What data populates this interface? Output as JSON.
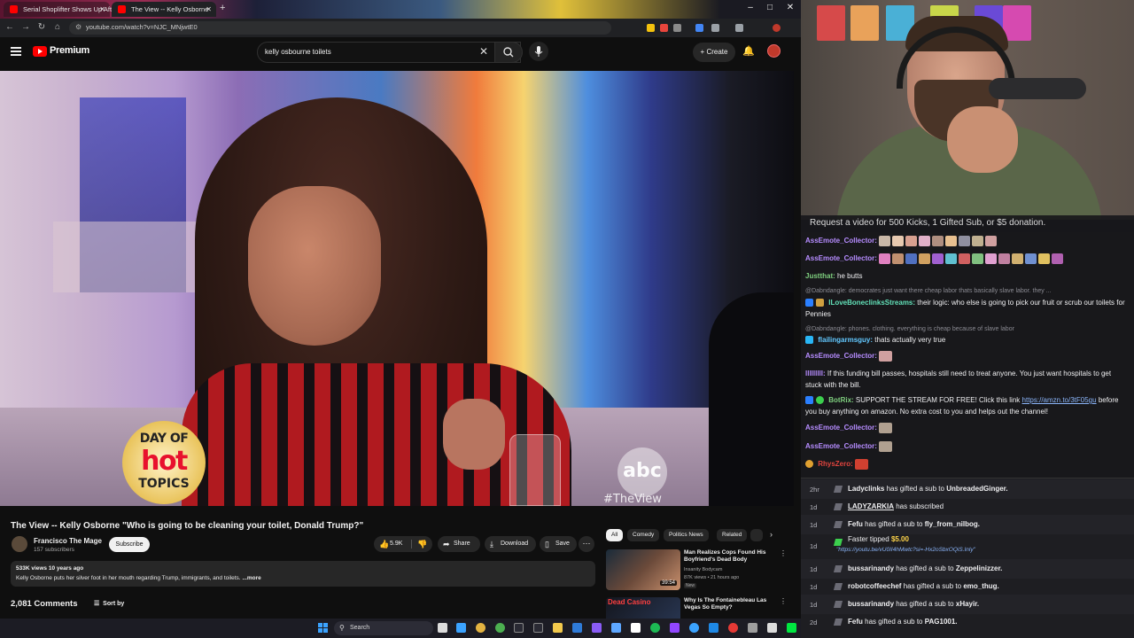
{
  "browser": {
    "tabs": [
      {
        "title": "Serial Shoplifter Shows Up Aft..."
      },
      {
        "title": "The View -- Kelly Osborne"
      }
    ],
    "url": "youtube.com/watch?v=NJC_MNjwtE0"
  },
  "youtube": {
    "brand": "Premium",
    "search_query": "kelly osbourne toilets",
    "create_label": "Create",
    "video": {
      "overlay_line1": "DAY OF",
      "overlay_line2": "hot",
      "overlay_line3": "TOPICS",
      "watermark": "abc",
      "hashtag": "#TheView"
    },
    "title": "The View -- Kelly Osborne \"Who is going to be cleaning your toilet, Donald Trump?\"",
    "channel": {
      "name": "Francisco The Mage",
      "subscribers": "157 subscribers",
      "subscribe_label": "Subscribe"
    },
    "actions": {
      "likes": "5.9K",
      "share": "Share",
      "download": "Download",
      "save": "Save"
    },
    "description": {
      "meta": "533K views  10 years ago",
      "text": "Kelly Osborne puts her silver foot in her mouth regarding Trump, immigrants, and toilets.",
      "more": "...more"
    },
    "comments": {
      "count": "2,081 Comments",
      "sort_label": "Sort by"
    },
    "chips": [
      "All",
      "Comedy",
      "Politics News",
      "Related"
    ],
    "related": [
      {
        "title": "Man Realizes Cops Found His Boyfriend's Dead Body",
        "channel": "Insanity Bodycam",
        "meta": "87K views • 21 hours ago",
        "badge": "New",
        "duration": "39:54"
      },
      {
        "title": "Why Is The Fontainebleau Las Vegas So Empty?",
        "thumb_text": "Dead Casino",
        "channel": "",
        "meta": "",
        "badge": "",
        "duration": ""
      }
    ]
  },
  "taskbar": {
    "search_label": "Search"
  },
  "stream": {
    "banner": "Request a video for 500 Kicks, 1 Gifted Sub, or $5 donation.",
    "chat": [
      {
        "user": "AssEmote_Collector:",
        "color": "#b68cff",
        "emotes": 9
      },
      {
        "user": "AssEmote_Collector:",
        "color": "#b68cff",
        "emotes": 14
      },
      {
        "user": "Justthat:",
        "color": "#7fd07f",
        "text": "he butts"
      },
      {
        "reply": "@Dabndangle: democrates just want there cheap labor thats basically slave labor. they ..."
      },
      {
        "user": "ILoveBoneclinksStreams:",
        "color": "#62e0b8",
        "text": "their logic: who else is going to pick our fruit or scrub our toilets for Pennies"
      },
      {
        "reply": "@Dabndangle: phones. clothing. everything is cheap because of slave labor"
      },
      {
        "user": "flailingarmsguy:",
        "color": "#62c8ff",
        "text": "thats actually very true"
      },
      {
        "user": "AssEmote_Collector:",
        "color": "#b68cff",
        "emotes": 1
      },
      {
        "user": "lllllllll:",
        "color": "#b68cff",
        "text": "If this funding bill passes, hospitals still need to treat anyone. You just want hospitals to get stuck with the bill."
      },
      {
        "user": "BotRix:",
        "color": "#7fd07f",
        "text": "SUPPORT THE STREAM FOR FREE! Click this link",
        "link": "https://amzn.to/3tF05gu",
        "text2": "before you buy anything on amazon. No extra cost to you and helps out the channel!"
      },
      {
        "user": "AssEmote_Collector:",
        "color": "#b68cff",
        "emotes": 1
      },
      {
        "user": "AssEmote_Collector:",
        "color": "#b68cff",
        "emotes": 1
      },
      {
        "user": "RhysZero:",
        "color": "#e0443e",
        "emotes": 1
      }
    ],
    "events": [
      {
        "time": "2hr",
        "user": "Ladyclinks",
        "action": "has gifted a sub to",
        "target": "UnbreadedGinger."
      },
      {
        "time": "1d",
        "user": "LADYZARKIA",
        "action": "has subscribed",
        "target": ""
      },
      {
        "time": "1d",
        "user": "Fefu",
        "action": "has gifted a sub to",
        "target": "fly_from_nilbog."
      },
      {
        "time": "1d",
        "user": "Faster",
        "action": "tipped",
        "target": "$5.00",
        "sub": "\"https://youtu.be/vU0II4hMwtc?si=-Hx2oSbxOQiS.Inly\""
      },
      {
        "time": "1d",
        "user": "bussarinandy",
        "action": "has gifted a sub to",
        "target": "Zeppelinizzer."
      },
      {
        "time": "1d",
        "user": "robotcoffeechef",
        "action": "has gifted a sub to",
        "target": "emo_thug."
      },
      {
        "time": "1d",
        "user": "bussarinandy",
        "action": "has gifted a sub to",
        "target": "xHayir."
      },
      {
        "time": "2d",
        "user": "Fefu",
        "action": "has gifted a sub to",
        "target": "PAG1001."
      }
    ]
  }
}
